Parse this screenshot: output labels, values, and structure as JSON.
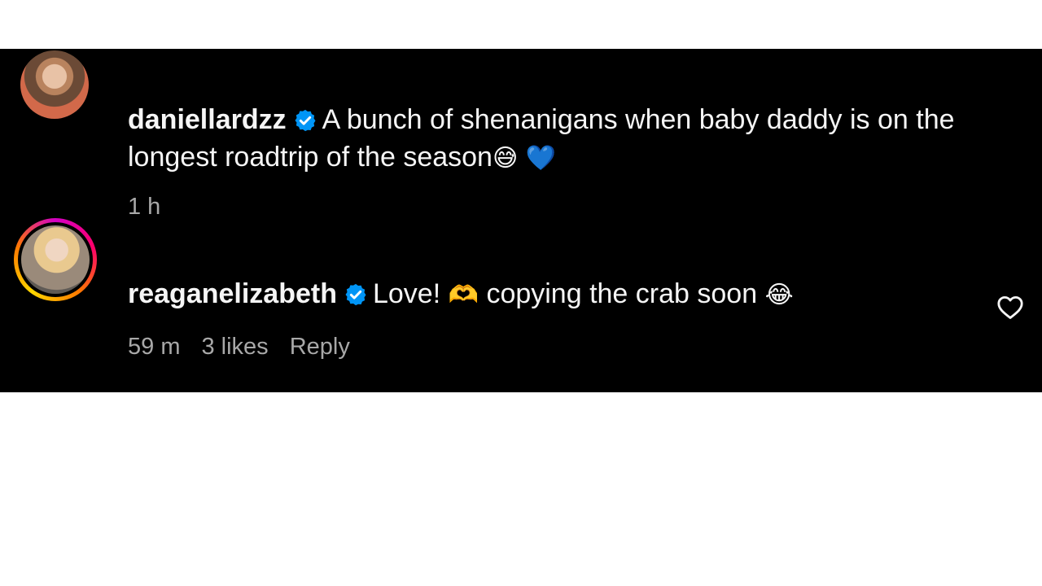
{
  "comments": [
    {
      "username": "daniellardzz",
      "text_line1": "A bunch of shenanigans when baby daddy is on the",
      "text_line2": "longest roadtrip of the season",
      "emoji_1": "😅",
      "emoji_2": "💙",
      "time": "1 h"
    },
    {
      "username": "reaganelizabeth",
      "text_before": "Love!",
      "emoji_1": "🫶",
      "text_after": "copying the crab soon",
      "emoji_2": "😂",
      "time": "59 m",
      "likes": "3 likes",
      "reply_label": "Reply"
    }
  ],
  "icons": {
    "verified": "verified-badge-icon",
    "like": "heart-outline-icon"
  },
  "colors": {
    "background": "#000000",
    "text": "#f5f5f5",
    "meta": "#a8a8a8",
    "verified": "#0095f6"
  }
}
